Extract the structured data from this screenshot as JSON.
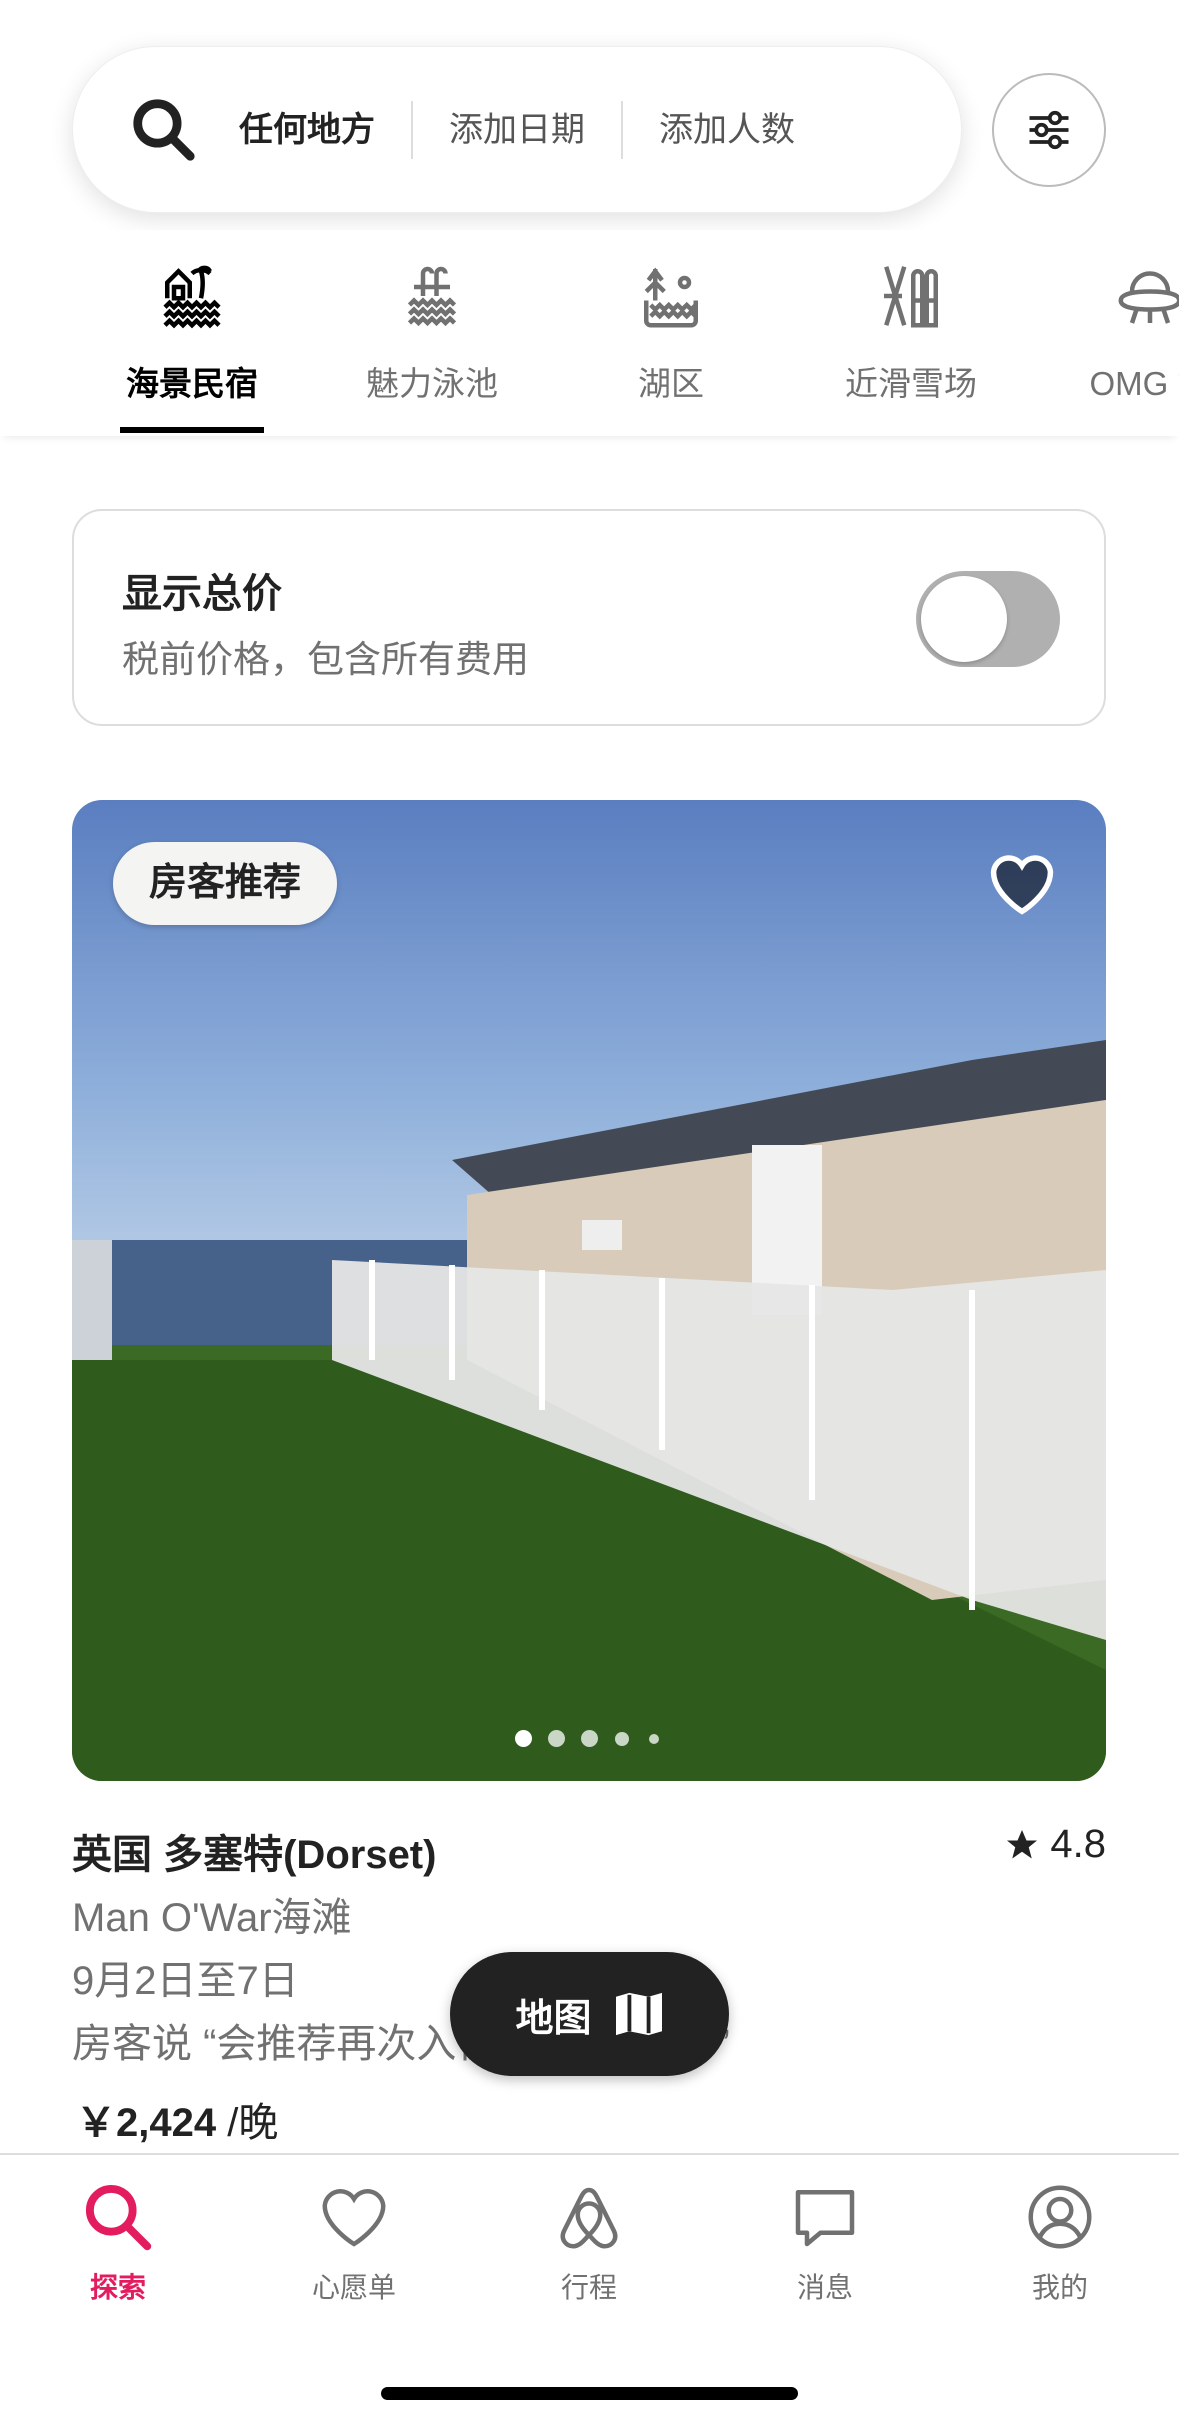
{
  "search": {
    "location": "任何地方",
    "dates": "添加日期",
    "guests": "添加人数"
  },
  "categories": [
    {
      "label": "海景民宿",
      "icon": "beach-house-icon",
      "active": true
    },
    {
      "label": "魅力泳池",
      "icon": "pool-icon"
    },
    {
      "label": "湖区",
      "icon": "lake-icon"
    },
    {
      "label": "近滑雪场",
      "icon": "ski-icon"
    },
    {
      "label": "OMG 妙",
      "icon": "ufo-icon"
    }
  ],
  "total_price": {
    "title": "显示总价",
    "subtitle": "税前价格，包含所有费用",
    "enabled": false
  },
  "listing": {
    "badge": "房客推荐",
    "title": "英国 多塞特(Dorset)",
    "rating": "4.8",
    "location": "Man O'War海滩",
    "dates": "9月2日至7日",
    "review": "房客说 “会推荐再次入住，非常漂亮。”",
    "price": "￥2,424",
    "price_unit": " /晚",
    "photo_count": 5,
    "current_photo": 1
  },
  "map_button": "地图",
  "tabs": [
    {
      "label": "探索",
      "active": true
    },
    {
      "label": "心愿单"
    },
    {
      "label": "行程"
    },
    {
      "label": "消息"
    },
    {
      "label": "我的"
    }
  ],
  "colors": {
    "accent": "#e31c5f",
    "text": "#222222",
    "muted": "#717171"
  }
}
